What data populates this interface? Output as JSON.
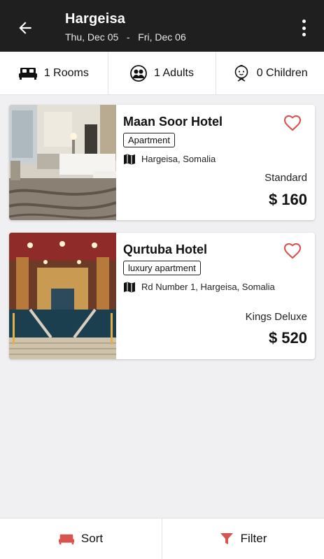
{
  "header": {
    "city": "Hargeisa",
    "dates": "Thu, Dec 05   -   Fri, Dec 06"
  },
  "occupancy": {
    "rooms": "1 Rooms",
    "adults": "1 Adults",
    "children": "0 Children"
  },
  "hotels": [
    {
      "name": "Maan Soor Hotel",
      "type": "Apartment",
      "location": "Hargeisa, Somalia",
      "room": "Standard",
      "price": "$ 160"
    },
    {
      "name": "Qurtuba Hotel",
      "type": "luxury apartment",
      "location": "Rd Number 1, Hargeisa, Somalia",
      "room": "Kings Deluxe",
      "price": "$ 520"
    }
  ],
  "bottom_bar": {
    "sort_label": "Sort",
    "filter_label": "Filter"
  },
  "colors": {
    "accent": "#d9534f",
    "appbar": "#1f1f1f",
    "background": "#f0f0f2"
  },
  "icons": [
    "back-arrow-icon",
    "more-vert-icon",
    "bed-icon",
    "adults-icon",
    "child-icon",
    "heart-outline-icon",
    "map-icon",
    "sort-bed-icon",
    "filter-funnel-icon"
  ]
}
